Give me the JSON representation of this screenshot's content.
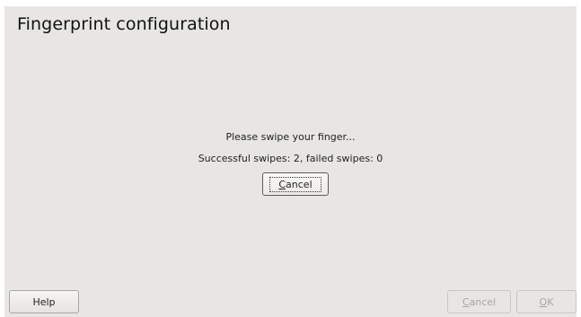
{
  "dialog": {
    "title": "Fingerprint configuration",
    "prompt": "Please swipe your finger...",
    "status": "Successful swipes: 2, failed swipes: 0",
    "cancel_center": {
      "mnemonic": "C",
      "rest": "ancel",
      "enabled": true
    },
    "buttons": {
      "help": "Help",
      "cancel": {
        "mnemonic": "C",
        "rest": "ancel",
        "enabled": false
      },
      "ok": {
        "mnemonic": "O",
        "rest": "K",
        "enabled": false
      }
    }
  }
}
